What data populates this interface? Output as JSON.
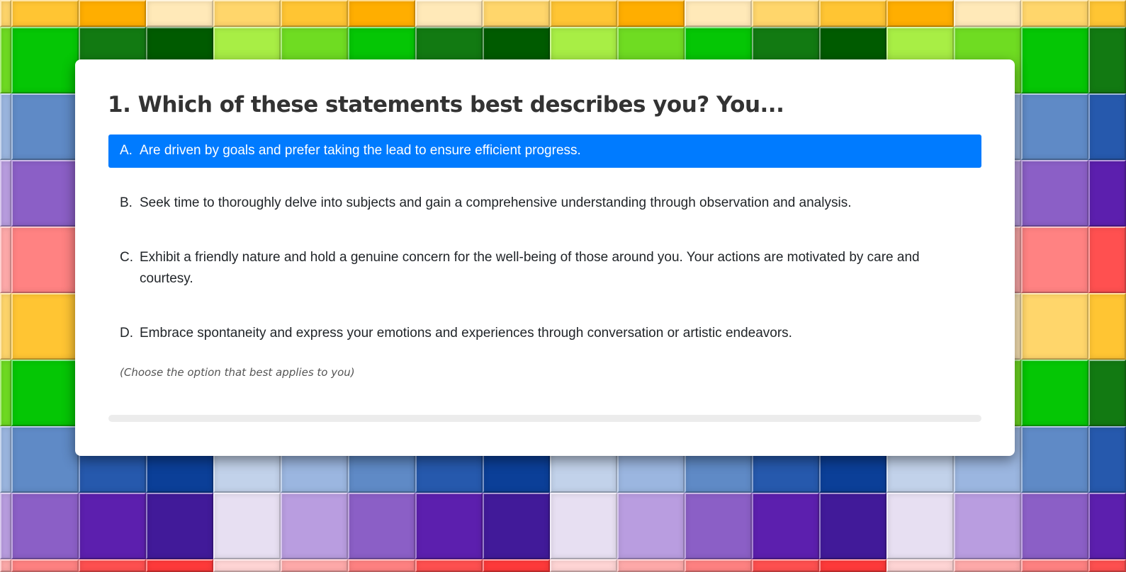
{
  "quiz": {
    "question_title": "1. Which of these statements best describes you? You...",
    "options": [
      {
        "letter": "A.",
        "text": "Are driven by goals and prefer taking the lead to ensure efficient progress.",
        "selected": true
      },
      {
        "letter": "B.",
        "text": "Seek time to thoroughly delve into subjects and gain a comprehensive understanding through observation and analysis.",
        "selected": false
      },
      {
        "letter": "C.",
        "text": "Exhibit a friendly nature and hold a genuine concern for the well-being of those around you. Your actions are motivated by care and courtesy.",
        "selected": false
      },
      {
        "letter": "D.",
        "text": "Embrace spontaneity and express your emotions and experiences through conversation or artistic endeavors.",
        "selected": false
      }
    ],
    "hint": "(Choose the option that best applies to you)",
    "progress_percent": 0
  },
  "colors": {
    "selected_background": "#007bff",
    "card_background": "#ffffff",
    "title_text": "#333333",
    "progress_track": "#ececec"
  },
  "background": {
    "pattern": "colored-tile-grid",
    "palettes": {
      "yellow": [
        "#ffe9b8",
        "#ffd66b",
        "#ffc533",
        "#ffae00"
      ],
      "green": [
        "#a8ee45",
        "#6fdc22",
        "#05c605",
        "#127a12",
        "#005b00"
      ],
      "blue": [
        "#c2d2ea",
        "#9bb6e0",
        "#5f8ac6",
        "#2659ad",
        "#0b3f98"
      ],
      "purple": [
        "#e7dff2",
        "#b99de0",
        "#8b5fc6",
        "#5c1fae",
        "#411a99"
      ],
      "red": [
        "#ffd5d5",
        "#ffaaaa",
        "#ff8282",
        "#ff5050",
        "#ff3a3a"
      ]
    }
  }
}
